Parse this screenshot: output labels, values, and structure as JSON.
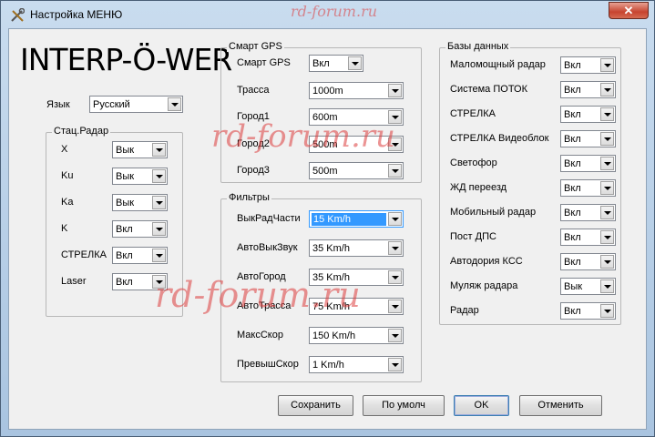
{
  "window": {
    "title": "Настройка МЕНЮ",
    "close_label": "✕"
  },
  "watermark": "rd-forum.ru",
  "logo": "INTERP-Ö-WER",
  "language": {
    "label": "Язык",
    "value": "Русский"
  },
  "stat_radar": {
    "title": "Стац.Радар",
    "rows": [
      {
        "label": "X",
        "value": "Вык"
      },
      {
        "label": "Ku",
        "value": "Вык"
      },
      {
        "label": "Ka",
        "value": "Вык"
      },
      {
        "label": "K",
        "value": "Вкл"
      },
      {
        "label": "СТРЕЛКА",
        "value": "Вкл"
      },
      {
        "label": "Laser",
        "value": "Вкл"
      }
    ]
  },
  "smart_gps": {
    "title": "Смарт GPS",
    "rows": [
      {
        "label": "Смарт GPS",
        "value": "Вкл"
      },
      {
        "label": "Трасса",
        "value": "1000m"
      },
      {
        "label": "Город1",
        "value": "600m"
      },
      {
        "label": "Город2",
        "value": "500m"
      },
      {
        "label": "Город3",
        "value": "500m"
      }
    ]
  },
  "filters": {
    "title": "Фильтры",
    "rows": [
      {
        "label": "ВыкРадЧасти",
        "value": "15 Km/h"
      },
      {
        "label": "АвтоВыкЗвук",
        "value": "35 Km/h"
      },
      {
        "label": "АвтоГород",
        "value": "35 Km/h"
      },
      {
        "label": "АвтоТрасса",
        "value": "75 Km/h"
      },
      {
        "label": "МаксСкор",
        "value": "150 Km/h"
      },
      {
        "label": "ПревышСкор",
        "value": "1 Km/h"
      }
    ]
  },
  "databases": {
    "title": "Базы данных",
    "rows": [
      {
        "label": "Маломощный радар",
        "value": "Вкл"
      },
      {
        "label": "Система ПОТОК",
        "value": "Вкл"
      },
      {
        "label": "СТРЕЛКА",
        "value": "Вкл"
      },
      {
        "label": "СТРЕЛКА Видеоблок",
        "value": "Вкл"
      },
      {
        "label": "Светофор",
        "value": "Вкл"
      },
      {
        "label": "ЖД переезд",
        "value": "Вкл"
      },
      {
        "label": "Мобильный радар",
        "value": "Вкл"
      },
      {
        "label": "Пост ДПС",
        "value": "Вкл"
      },
      {
        "label": "Автодория КСС",
        "value": "Вкл"
      },
      {
        "label": "Муляж радара",
        "value": "Вык"
      },
      {
        "label": "Радар",
        "value": "Вкл"
      }
    ]
  },
  "buttons": {
    "save": "Сохранить",
    "default": "По умолч",
    "ok": "OK",
    "cancel": "Отменить"
  },
  "colors": {
    "accent": "#3399ff",
    "close": "#c7442f",
    "watermark": "#dc3c3c"
  }
}
